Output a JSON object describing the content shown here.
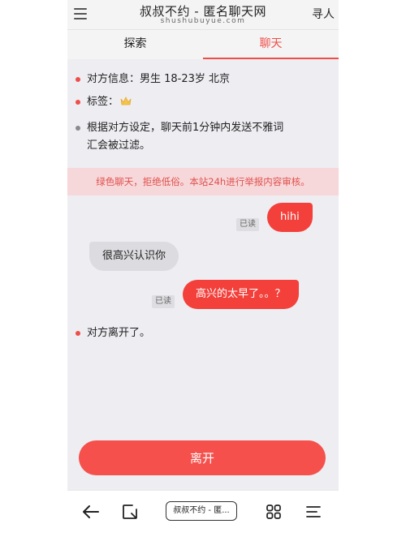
{
  "header": {
    "title": "叔叔不约 - 匿名聊天网",
    "domain": "shushubuyue.com",
    "find_label": "寻人"
  },
  "tabs": [
    {
      "label": "探索",
      "active": false
    },
    {
      "label": "聊天",
      "active": true
    }
  ],
  "partner_info": {
    "info_line": "对方信息：男生 18-23岁 北京",
    "tags_label": "标签：",
    "filter_notice_line1": "根据对方设定，聊天前1分钟内发送不雅词",
    "filter_notice_line2": "汇会被过滤。"
  },
  "banner": "绿色聊天，拒绝低俗。本站24h进行举报内容审核。",
  "messages": [
    {
      "from": "me",
      "text": "hihi",
      "read": "已读"
    },
    {
      "from": "other",
      "text": "很高兴认识你"
    },
    {
      "from": "me",
      "text": "高兴的太早了。。？",
      "read": "已读"
    }
  ],
  "system_message": "对方离开了。",
  "leave_button": "离开",
  "browser_nav": {
    "tab_label": "叔叔不约 - 匿..."
  },
  "colors": {
    "accent": "#ef4d48",
    "bubble_me": "#f3403b",
    "bubble_other": "#dcdce0",
    "banner_bg": "#f7d8da"
  }
}
